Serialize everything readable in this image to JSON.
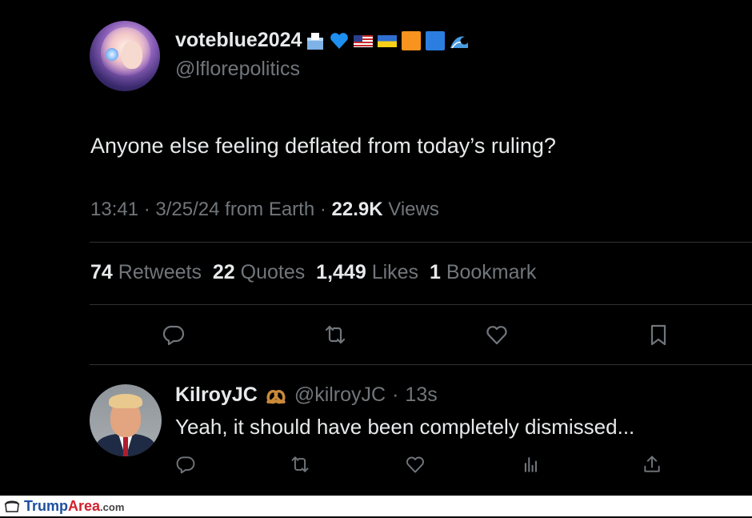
{
  "tweet": {
    "display_name": "voteblue2024",
    "handle": "@lflorepolitics",
    "name_emojis": [
      "ballot-box-emoji",
      "blue-heart-emoji",
      "us-flag-emoji",
      "ukraine-flag-emoji",
      "orange-square-emoji",
      "blue-square-emoji",
      "wave-emoji"
    ],
    "text": "Anyone else feeling deflated from today’s ruling?",
    "time": "13:41",
    "date": "3/25/24",
    "source": "from Earth",
    "views_count": "22.9K",
    "views_label": "Views",
    "stats": {
      "retweets_count": "74",
      "retweets_label": "Retweets",
      "quotes_count": "22",
      "quotes_label": "Quotes",
      "likes_count": "1,449",
      "likes_label": "Likes",
      "bookmarks_count": "1",
      "bookmarks_label": "Bookmark"
    },
    "actions": [
      "reply-icon",
      "retweet-icon",
      "like-icon",
      "bookmark-icon"
    ]
  },
  "reply": {
    "display_name": "KilroyJC",
    "name_emoji": "pretzel-emoji",
    "handle": "@kilroyJC",
    "separator": "·",
    "time_ago": "13s",
    "text": "Yeah, it should have been completely dismissed...",
    "actions": [
      "reply-icon",
      "retweet-icon",
      "like-icon",
      "views-icon",
      "share-icon"
    ]
  },
  "footer": {
    "brand_primary": "Trump",
    "brand_secondary": "Area",
    "brand_suffix": ".com"
  },
  "colors": {
    "background": "#000000",
    "text": "#e7e9ea",
    "secondary_text": "#71767b",
    "divider": "#2f3336",
    "brand_blue": "#1f4fa0",
    "brand_red": "#d21f2b"
  }
}
